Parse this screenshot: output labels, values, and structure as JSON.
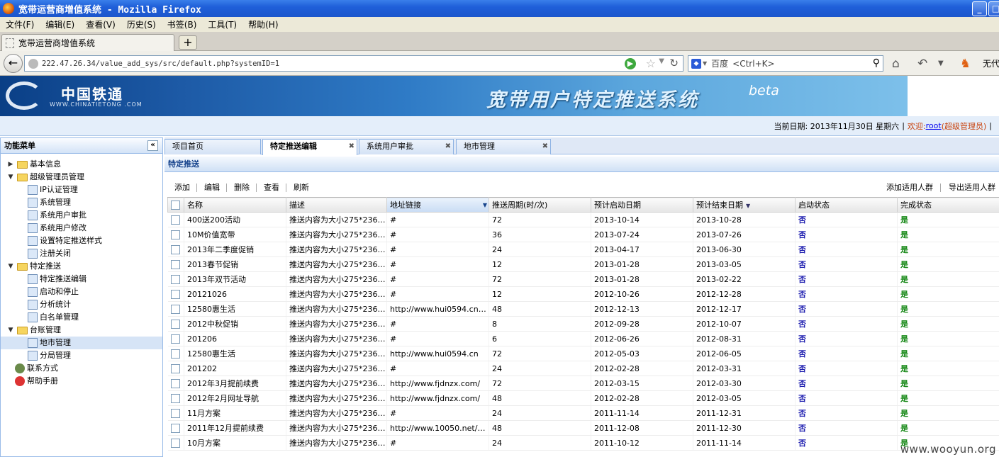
{
  "window": {
    "title": "宽带运营商增值系统 - Mozilla Firefox"
  },
  "menu": [
    "文件(F)",
    "编辑(E)",
    "查看(V)",
    "历史(S)",
    "书签(B)",
    "工具(T)",
    "帮助(H)"
  ],
  "browser_tab": {
    "label": "宽带运营商增值系统",
    "new_tab": "+"
  },
  "address": {
    "url": "222.47.26.34/value_add_sys/src/default.php?systemID=1"
  },
  "search": {
    "engine": "百度",
    "placeholder": "<Ctrl+K>"
  },
  "toolbar_extra": "无代",
  "banner": {
    "logo_cn": "中国铁通",
    "logo_en": "WWW.CHINATIETONG .COM",
    "title": "宽带用户特定推送系统",
    "beta": "beta"
  },
  "info": {
    "date_text": "当前日期: 2013年11月30日 星期六",
    "sep": "|",
    "welcome": "欢迎:",
    "user": "root",
    "role": "(超级管理员)"
  },
  "sidebar": {
    "title": "功能菜单",
    "items": [
      {
        "type": "group",
        "toggle": "▶",
        "label": "基本信息"
      },
      {
        "type": "group",
        "toggle": "▼",
        "label": "超级管理员管理"
      },
      {
        "type": "leaf",
        "label": "IP认证管理"
      },
      {
        "type": "leaf",
        "label": "系统管理"
      },
      {
        "type": "leaf",
        "label": "系统用户审批"
      },
      {
        "type": "leaf",
        "label": "系统用户修改"
      },
      {
        "type": "leaf",
        "label": "设置特定推送样式"
      },
      {
        "type": "leaf",
        "label": "注册关闭"
      },
      {
        "type": "group",
        "toggle": "▼",
        "label": "特定推送"
      },
      {
        "type": "leaf",
        "label": "特定推送编辑"
      },
      {
        "type": "leaf",
        "label": "启动和停止"
      },
      {
        "type": "leaf",
        "label": "分析统计"
      },
      {
        "type": "leaf",
        "label": "白名单管理"
      },
      {
        "type": "group",
        "toggle": "▼",
        "label": "台账管理"
      },
      {
        "type": "leaf",
        "label": "地市管理",
        "selected": true
      },
      {
        "type": "leaf",
        "label": "分局管理"
      },
      {
        "type": "top",
        "label": "联系方式"
      },
      {
        "type": "top",
        "label": "帮助手册"
      }
    ]
  },
  "tabs": [
    {
      "label": "项目首页",
      "closable": false
    },
    {
      "label": "特定推送编辑",
      "closable": true,
      "active": true
    },
    {
      "label": "系统用户审批",
      "closable": true
    },
    {
      "label": "地市管理",
      "closable": true
    }
  ],
  "panel": {
    "title": "特定推送"
  },
  "actions": {
    "left": [
      "添加",
      "编辑",
      "删除",
      "查看",
      "刷新"
    ],
    "right": [
      "添加适用人群",
      "导出适用人群"
    ]
  },
  "table": {
    "columns": [
      "名称",
      "描述",
      "地址链接",
      "推送周期(时/次)",
      "预计启动日期",
      "预计结束日期",
      "启动状态",
      "完成状态"
    ],
    "rows": [
      [
        "400送200活动",
        "推送内容为大小275*236(...",
        "#",
        "72",
        "2013-10-14",
        "2013-10-28",
        "否",
        "是"
      ],
      [
        "10M价值宽带",
        "推送内容为大小275*236(...",
        "#",
        "36",
        "2013-07-24",
        "2013-07-26",
        "否",
        "是"
      ],
      [
        "2013年二季度促销",
        "推送内容为大小275*236(...",
        "#",
        "24",
        "2013-04-17",
        "2013-06-30",
        "否",
        "是"
      ],
      [
        "2013春节促销",
        "推送内容为大小275*236(...",
        "#",
        "12",
        "2013-01-28",
        "2013-03-05",
        "否",
        "是"
      ],
      [
        "2013年双节活动",
        "推送内容为大小275*236(...",
        "#",
        "72",
        "2013-01-28",
        "2013-02-22",
        "否",
        "是"
      ],
      [
        "20121026",
        "推送内容为大小275*236(...",
        "#",
        "12",
        "2012-10-26",
        "2012-12-28",
        "否",
        "是"
      ],
      [
        "12580惠生活",
        "推送内容为大小275*236(...",
        "http://www.hui0594.cn/n...",
        "48",
        "2012-12-13",
        "2012-12-17",
        "否",
        "是"
      ],
      [
        "2012中秋促销",
        "推送内容为大小275*236(...",
        "#",
        "8",
        "2012-09-28",
        "2012-10-07",
        "否",
        "是"
      ],
      [
        "201206",
        "推送内容为大小275*236(...",
        "#",
        "6",
        "2012-06-26",
        "2012-08-31",
        "否",
        "是"
      ],
      [
        "12580惠生活",
        "推送内容为大小275*236(...",
        "http://www.hui0594.cn",
        "72",
        "2012-05-03",
        "2012-06-05",
        "否",
        "是"
      ],
      [
        "201202",
        "推送内容为大小275*236(...",
        "#",
        "24",
        "2012-02-28",
        "2012-03-31",
        "否",
        "是"
      ],
      [
        "2012年3月提前续费",
        "推送内容为大小275*236(...",
        "http://www.fjdnzx.com/",
        "72",
        "2012-03-15",
        "2012-03-30",
        "否",
        "是"
      ],
      [
        "2012年2月网址导航",
        "推送内容为大小275*236(...",
        "http://www.fjdnzx.com/",
        "48",
        "2012-02-28",
        "2012-03-05",
        "否",
        "是"
      ],
      [
        "11月方案",
        "推送内容为大小275*236(...",
        "#",
        "24",
        "2011-11-14",
        "2011-12-31",
        "否",
        "是"
      ],
      [
        "2011年12月提前续费",
        "推送内容为大小275*236(...",
        "http://www.10050.net/Ht...",
        "48",
        "2011-12-08",
        "2011-12-30",
        "否",
        "是"
      ],
      [
        "10月方案",
        "推送内容为大小275*236(...",
        "#",
        "24",
        "2011-10-12",
        "2011-11-14",
        "否",
        "是"
      ]
    ]
  },
  "watermark": "www.wooyun.org"
}
